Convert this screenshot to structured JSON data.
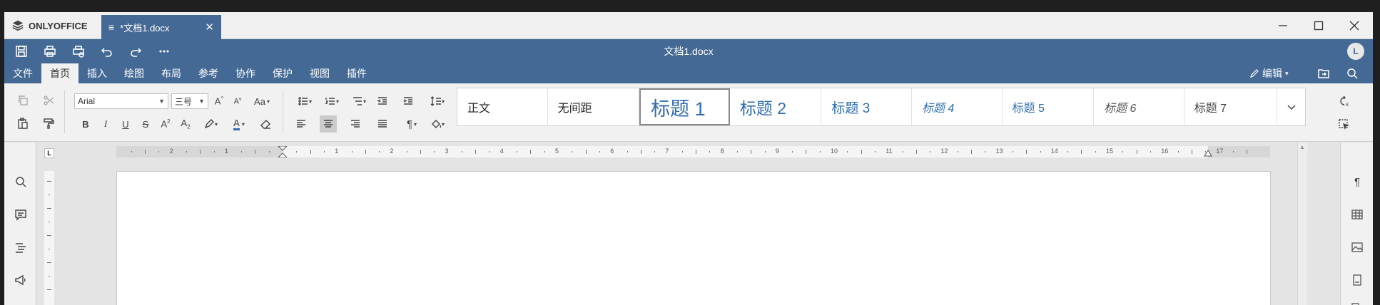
{
  "titlebar": {
    "app_name": "ONLYOFFICE",
    "tab_title": "*文档1.docx"
  },
  "header": {
    "document_title": "文档1.docx",
    "avatar_letter": "L",
    "edit_mode": "编辑"
  },
  "menu": {
    "tabs": [
      "文件",
      "首页",
      "插入",
      "绘图",
      "布局",
      "参考",
      "协作",
      "保护",
      "视图",
      "插件"
    ],
    "active_index": 1
  },
  "toolbar": {
    "font_name": "Arial",
    "font_size": "三号",
    "case_label": "Aa",
    "styles": [
      "正文",
      "无间距",
      "标题 1",
      "标题 2",
      "标题 3",
      "标题 4",
      "标题 5",
      "标题 6",
      "标题 7"
    ],
    "selected_style_index": 2
  },
  "ruler": {
    "labels": [
      "2",
      "1",
      "1",
      "2",
      "3",
      "4",
      "5",
      "6",
      "7",
      "8",
      "9",
      "10",
      "11",
      "12",
      "13",
      "14",
      "15",
      "16",
      "17"
    ],
    "corner": "L"
  },
  "colors": {
    "brand": "#446995",
    "heading": "#2f6db3"
  }
}
